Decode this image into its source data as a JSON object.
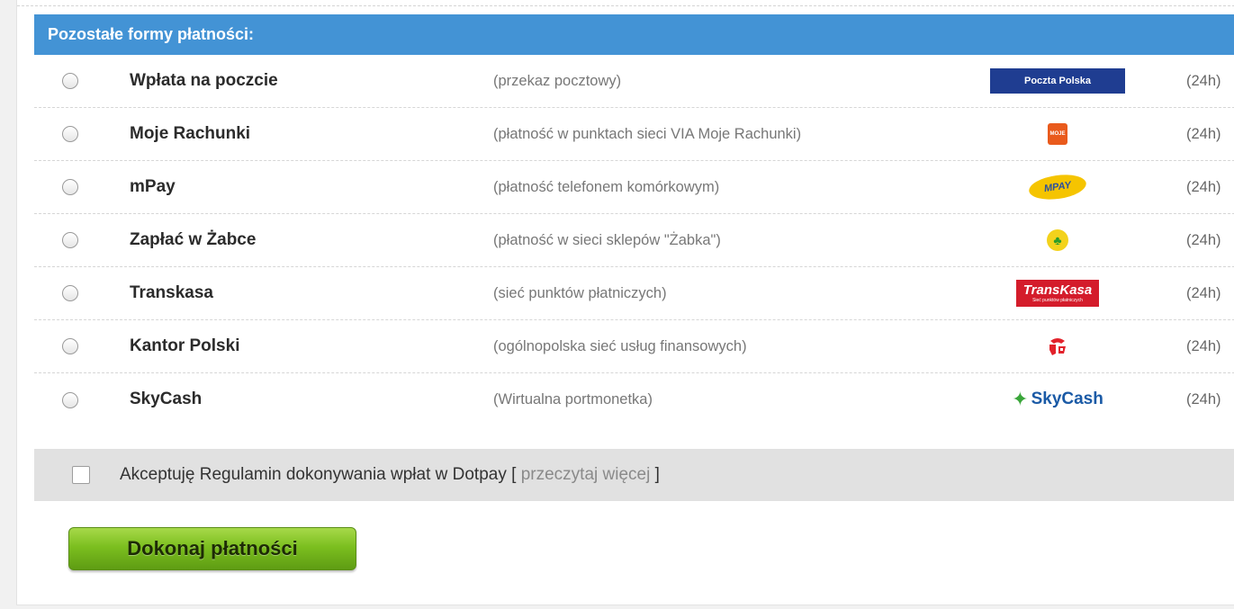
{
  "section": {
    "title": "Pozostałe formy płatności:"
  },
  "methods": [
    {
      "name": "Wpłata na poczcie",
      "description": "(przekaz pocztowy)",
      "time": "(24h)",
      "logo": "poczta-polska-logo",
      "logo_text": "Poczta Polska"
    },
    {
      "name": "Moje Rachunki",
      "description": "(płatność w punktach sieci VIA Moje Rachunki)",
      "time": "(24h)",
      "logo": "moje-rachunki-logo",
      "logo_text": "MOJE RACHUNKI"
    },
    {
      "name": "mPay",
      "description": "(płatność telefonem komórkowym)",
      "time": "(24h)",
      "logo": "mpay-logo",
      "logo_text": "MPAY"
    },
    {
      "name": "Zapłać w Żabce",
      "description": "(płatność w sieci sklepów \"Żabka\")",
      "time": "(24h)",
      "logo": "zabka-logo",
      "logo_text": ""
    },
    {
      "name": "Transkasa",
      "description": "(sieć punktów płatniczych)",
      "time": "(24h)",
      "logo": "transkasa-logo",
      "logo_text": "TransKasa",
      "logo_subtext": "Sieć punktów płatniczych"
    },
    {
      "name": "Kantor Polski",
      "description": "(ogólnopolska sieć usług finansowych)",
      "time": "(24h)",
      "logo": "kantor-polski-logo",
      "logo_text": ""
    },
    {
      "name": "SkyCash",
      "description": "(Wirtualna portmonetka)",
      "time": "(24h)",
      "logo": "skycash-logo",
      "logo_text": "SkyCash"
    }
  ],
  "terms": {
    "text": "Akceptuję Regulamin dokonywania wpłat w Dotpay",
    "bracket_open": "[",
    "link": "przeczytaj więcej",
    "bracket_close": "]"
  },
  "pay_button": {
    "label": "Dokonaj płatności"
  },
  "colors": {
    "header_bg": "#4393d5",
    "button_green": "#7cbf1f",
    "terms_bg": "#e1e1e1"
  }
}
